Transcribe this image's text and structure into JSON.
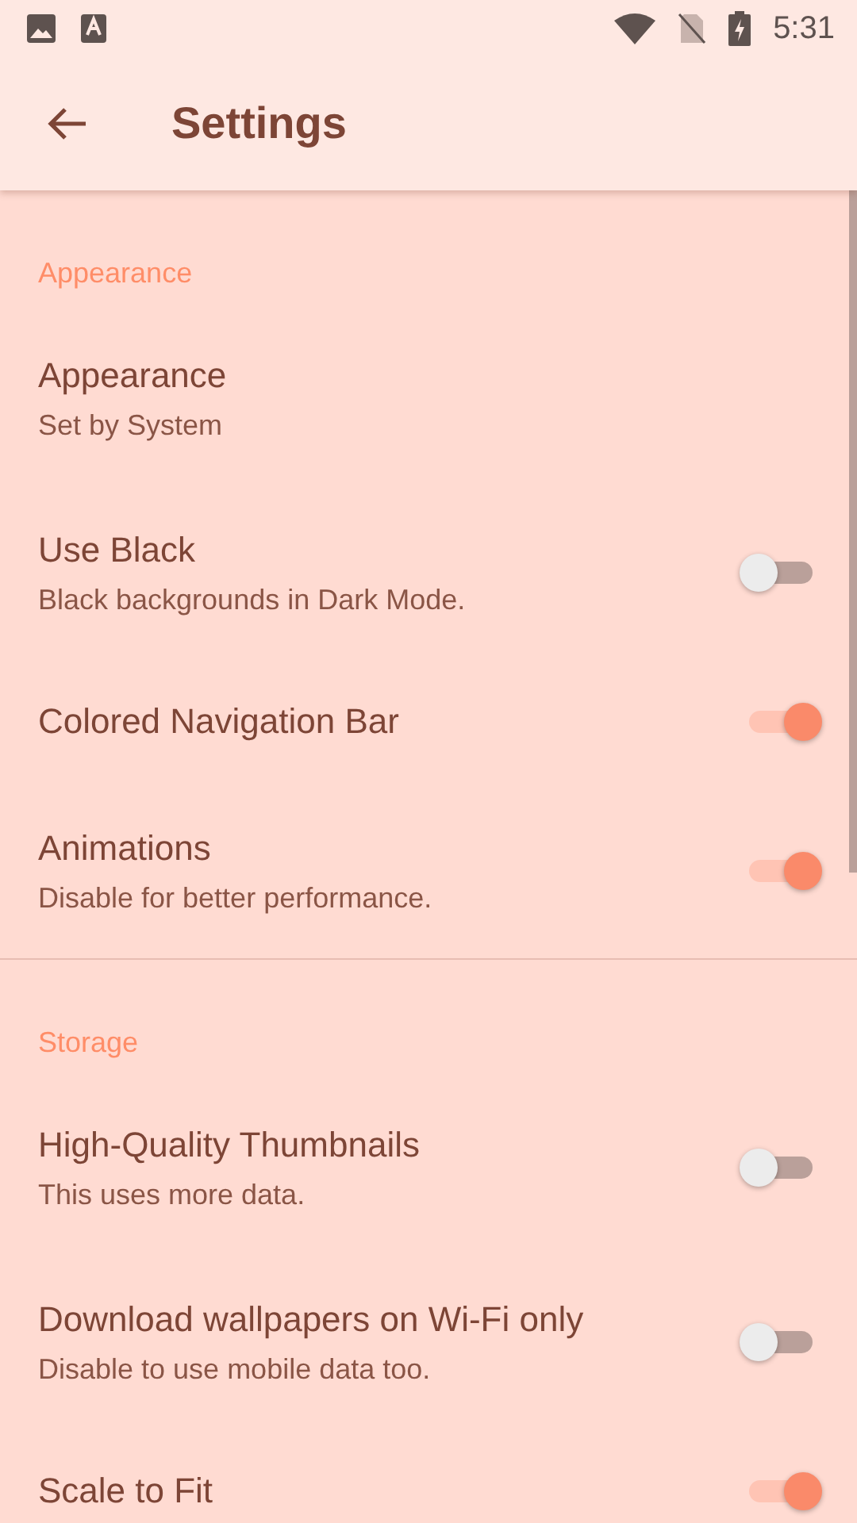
{
  "status_bar": {
    "time": "5:31"
  },
  "toolbar": {
    "title": "Settings"
  },
  "sections": [
    {
      "header": "Appearance",
      "items": [
        {
          "kind": "text",
          "title": "Appearance",
          "subtitle": "Set by System"
        },
        {
          "kind": "switch",
          "title": "Use Black",
          "subtitle": "Black backgrounds in Dark Mode.",
          "on": false
        },
        {
          "kind": "switch",
          "title": "Colored Navigation Bar",
          "on": true
        },
        {
          "kind": "switch",
          "title": "Animations",
          "subtitle": "Disable for better performance.",
          "on": true
        }
      ]
    },
    {
      "header": "Storage",
      "items": [
        {
          "kind": "switch",
          "title": "High-Quality Thumbnails",
          "subtitle": "This uses more data.",
          "on": false
        },
        {
          "kind": "switch",
          "title": "Download wallpapers on Wi-Fi only",
          "subtitle": "Disable to use mobile data too.",
          "on": false
        },
        {
          "kind": "switch",
          "title": "Scale to Fit",
          "on": true
        }
      ]
    }
  ]
}
